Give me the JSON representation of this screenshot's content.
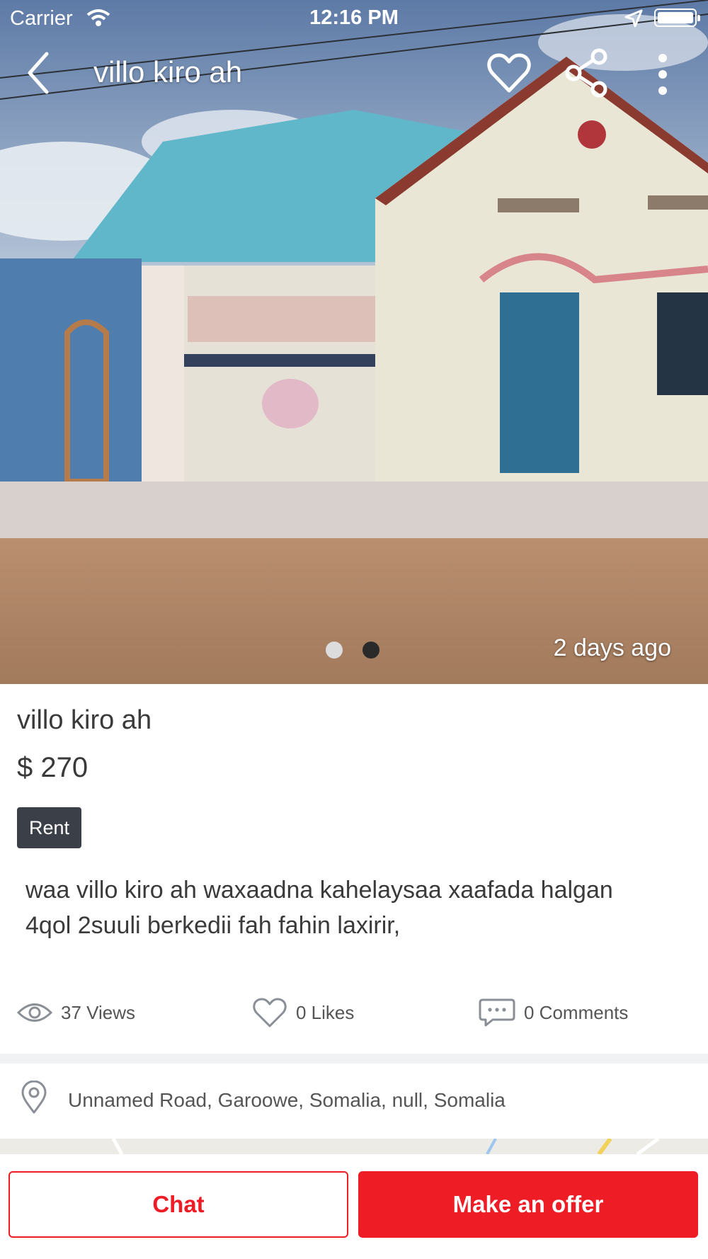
{
  "status_bar": {
    "carrier": "Carrier",
    "time": "12:16 PM"
  },
  "nav": {
    "title": "villo kiro ah"
  },
  "hero": {
    "posted": "2 days ago",
    "current_slide": 2,
    "total_slides": 2
  },
  "item": {
    "title": "villo kiro ah",
    "price": "$ 270",
    "badge": "Rent",
    "description": "waa villo kiro ah waxaadna kahelaysaa xaafada halgan 4qol 2suuli berkedii fah fahin laxirir,"
  },
  "stats": {
    "views": "37 Views",
    "likes": "0 Likes",
    "comments": "0 Comments"
  },
  "location": {
    "address": "Unnamed Road, Garoowe, Somalia, null, Somalia"
  },
  "actions": {
    "chat": "Chat",
    "offer": "Make an offer"
  },
  "colors": {
    "accent": "#ee1c25",
    "badge": "#3b4048"
  }
}
